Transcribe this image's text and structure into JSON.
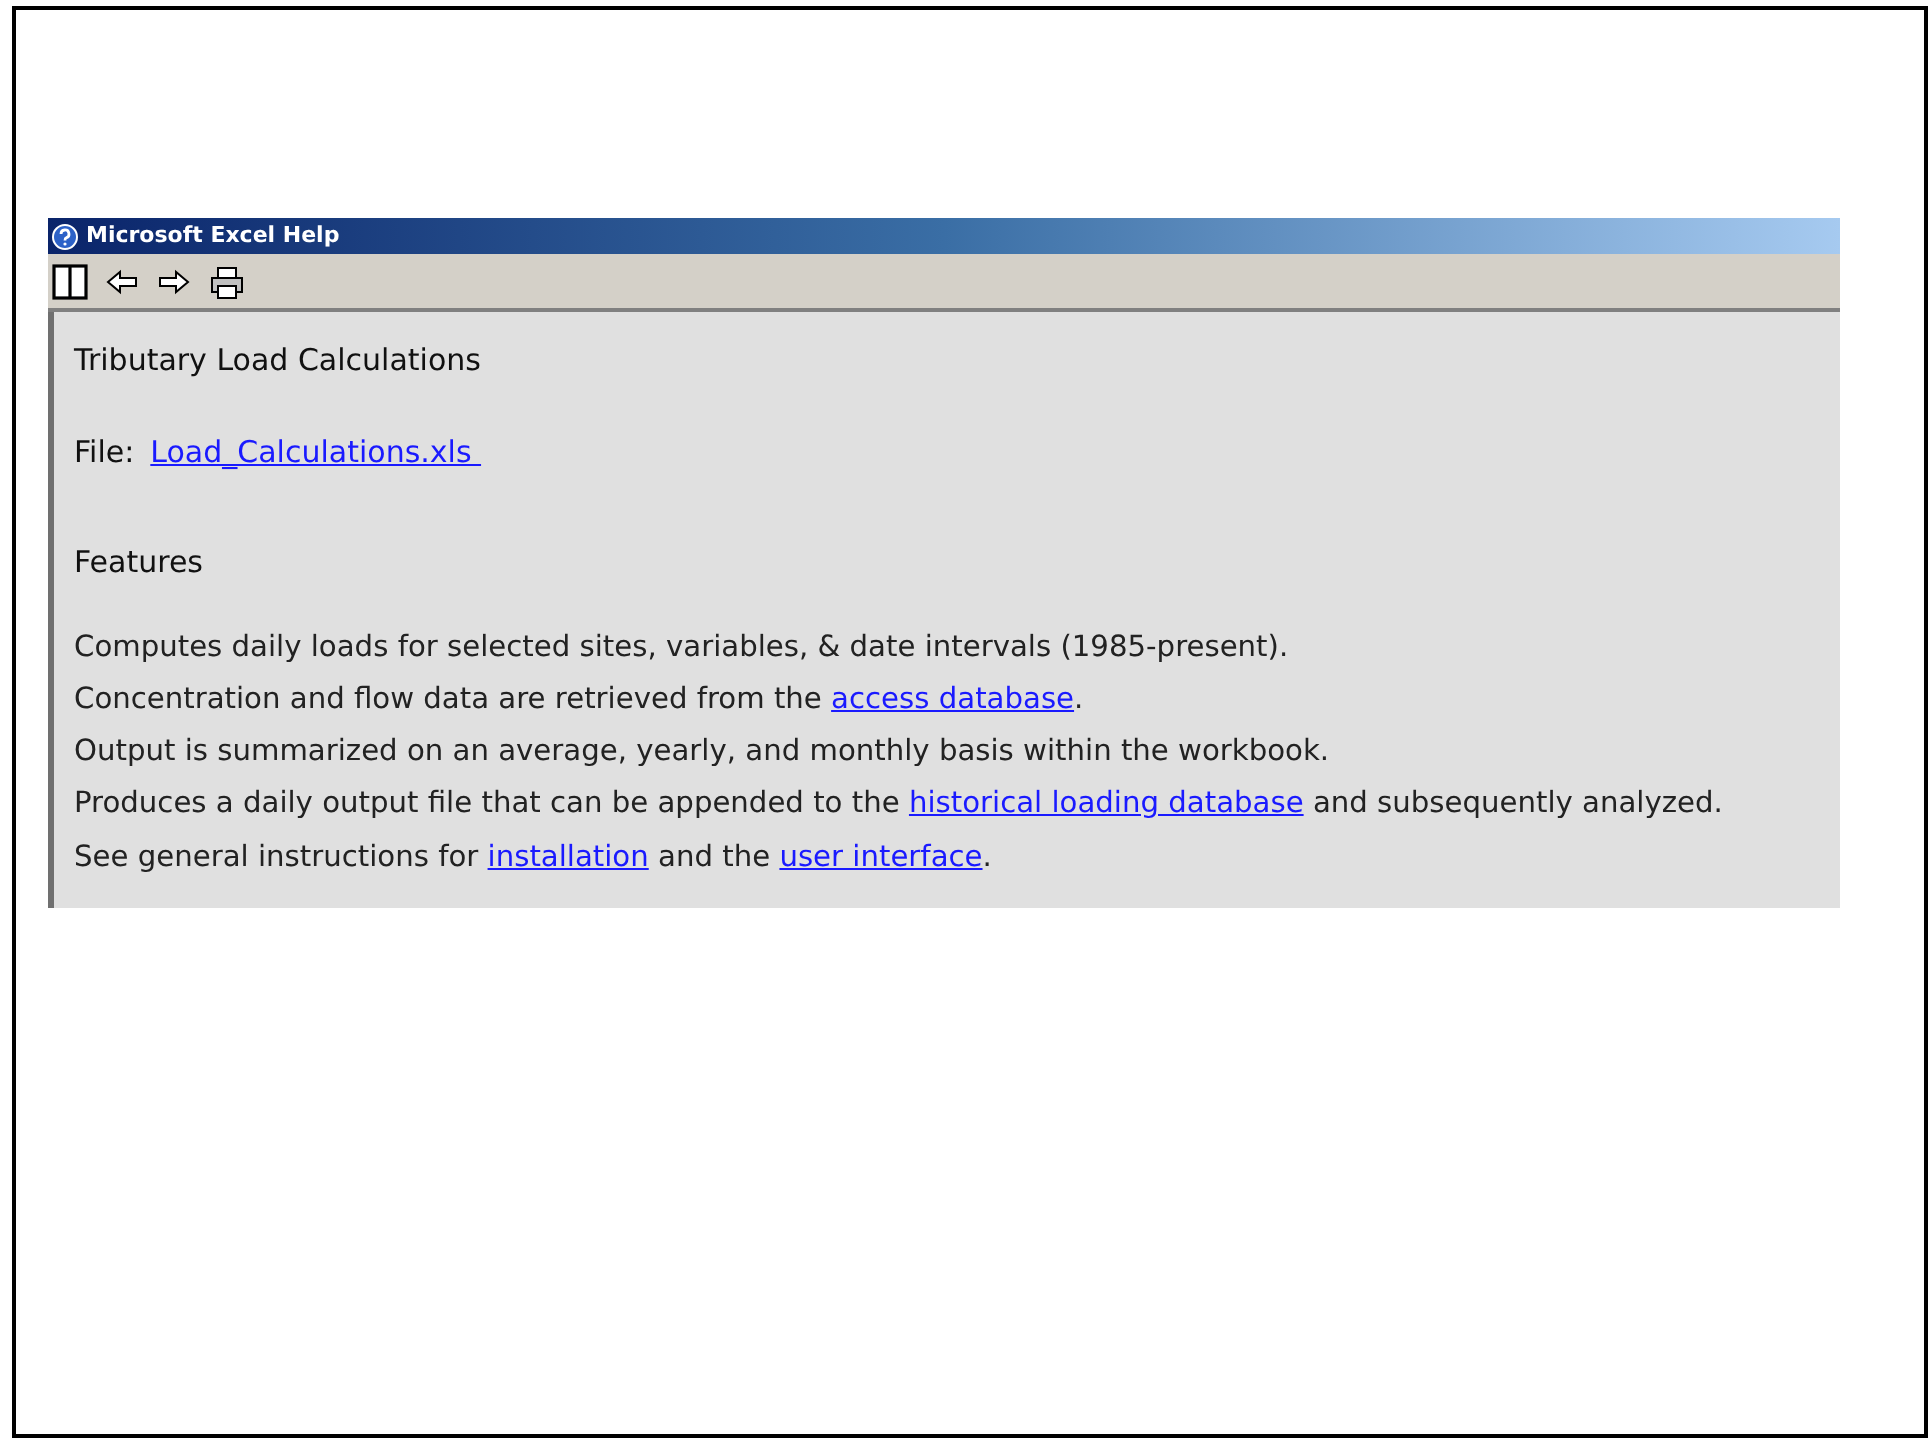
{
  "window": {
    "title": "Microsoft Excel Help"
  },
  "toolbar": {
    "buttons": [
      {
        "kind": "pane"
      },
      {
        "kind": "back"
      },
      {
        "kind": "forward"
      },
      {
        "kind": "print"
      }
    ]
  },
  "content": {
    "heading": "Tributary Load Calculations",
    "file": {
      "label": "File:",
      "link": "Load_Calculations.xls "
    },
    "section_heading": "Features",
    "lines": [
      [
        {
          "kind": "text",
          "text": "Computes daily loads for selected sites, variables, & date intervals (1985-present)."
        }
      ],
      [
        {
          "kind": "text",
          "text": "Concentration and flow data are retrieved from the "
        },
        {
          "kind": "link",
          "text": "access database"
        },
        {
          "kind": "text",
          "text": "."
        }
      ],
      [
        {
          "kind": "text",
          "text": "Output is summarized on an average, yearly, and monthly basis within the workbook."
        }
      ],
      [
        {
          "kind": "text",
          "text": "Produces a daily output file that can be appended to the "
        },
        {
          "kind": "link",
          "text": "historical loading database"
        },
        {
          "kind": "text",
          "text": " and subsequently analyzed."
        }
      ],
      [
        {
          "kind": "text",
          "text": "See general instructions for "
        },
        {
          "kind": "link",
          "text": "installation"
        },
        {
          "kind": "text",
          "text": " and the "
        },
        {
          "kind": "link",
          "text": "user interface"
        },
        {
          "kind": "text",
          "text": "."
        }
      ]
    ]
  }
}
